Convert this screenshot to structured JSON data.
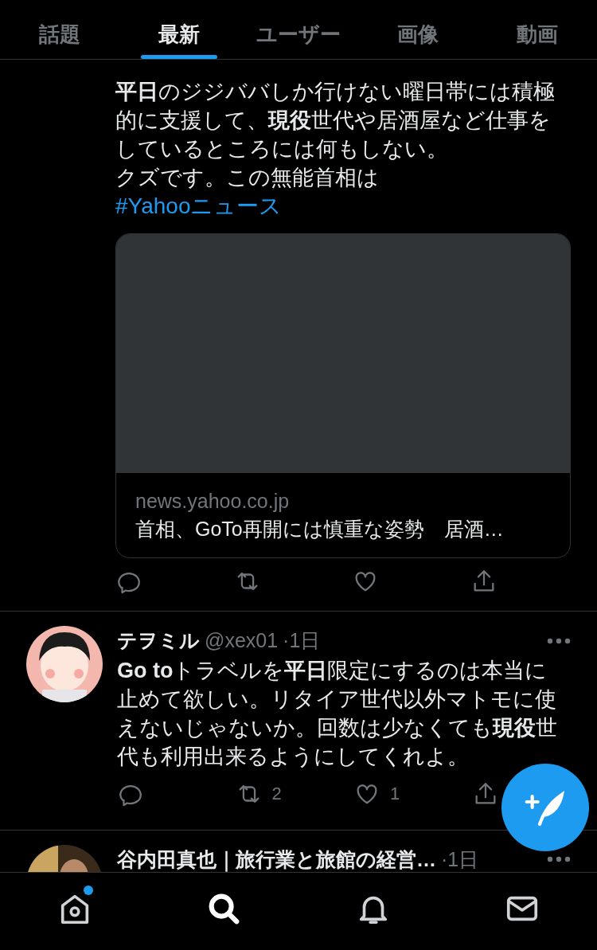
{
  "tabs": [
    {
      "label": "話題",
      "selected": false
    },
    {
      "label": "最新",
      "selected": true
    },
    {
      "label": "ユーザー",
      "selected": false
    },
    {
      "label": "画像",
      "selected": false
    },
    {
      "label": "動画",
      "selected": false
    }
  ],
  "tweets": [
    {
      "kind": "continued",
      "paragraphs": [
        "**平日**のジジババしか行けない曜日帯には積極的に支援して、**現役**世代や居酒屋など仕事をしているところには何もしない。",
        "クズです。この無能首相は"
      ],
      "hashtag": "#Yahooニュース",
      "link_card": {
        "domain": "news.yahoo.co.jp",
        "title": "首相、GoTo再開には慎重な姿勢　居酒…"
      },
      "actions": [
        {
          "kind": "reply"
        },
        {
          "kind": "retweet"
        },
        {
          "kind": "like"
        },
        {
          "kind": "share"
        }
      ]
    },
    {
      "kind": "full",
      "name": "テヲミル",
      "handle": "@xex01",
      "time": "·1日",
      "paragraphs": [
        "**Go to**トラベルを**平日**限定にするのは本当に止めて欲しい。リタイア世代以外マトモに使えないじゃないか。回数は少なくても**現役**世代も利用出来るようにしてくれよ。"
      ],
      "actions": [
        {
          "kind": "reply"
        },
        {
          "kind": "retweet",
          "count": "2"
        },
        {
          "kind": "like",
          "count": "1"
        },
        {
          "kind": "share"
        }
      ]
    },
    {
      "kind": "full",
      "name": "谷内田真也｜旅行業と旅館の経営…",
      "time": "·1日"
    }
  ],
  "nav": [
    {
      "kind": "home",
      "selected": false,
      "unread": true
    },
    {
      "kind": "search",
      "selected": true,
      "unread": false
    },
    {
      "kind": "bell",
      "selected": false,
      "unread": false
    },
    {
      "kind": "mail",
      "selected": false,
      "unread": false
    }
  ]
}
